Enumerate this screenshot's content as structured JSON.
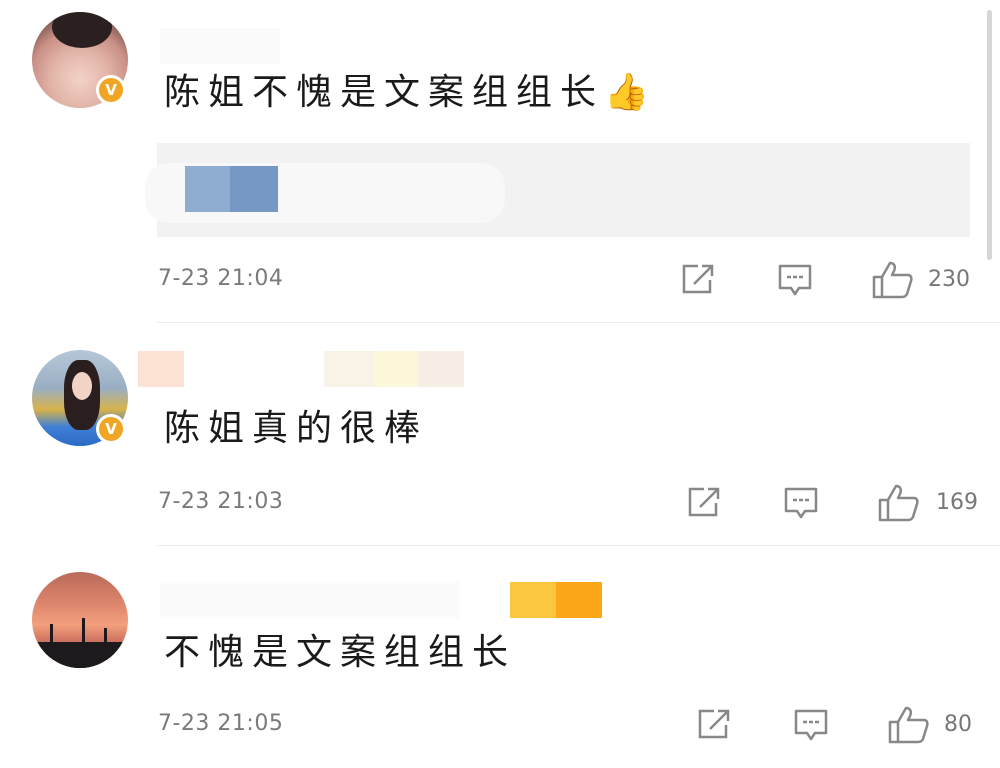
{
  "comments": [
    {
      "text": "陈姐不愧是文案组组长👍",
      "time": "7-23 21:04",
      "likes": "230",
      "has_quote": true,
      "badge_color": "#f5a623",
      "badge_label": "V"
    },
    {
      "text": "陈姐真的很棒",
      "time": "7-23 21:03",
      "likes": "169",
      "has_quote": false,
      "badge_color": "#f5a623",
      "badge_label": "V"
    },
    {
      "text": "不愧是文案组组长",
      "time": "7-23 21:05",
      "likes": "80",
      "has_quote": false
    }
  ],
  "icons": {
    "share": "share-icon",
    "comment": "comment-icon",
    "like": "thumbs-up-icon"
  }
}
